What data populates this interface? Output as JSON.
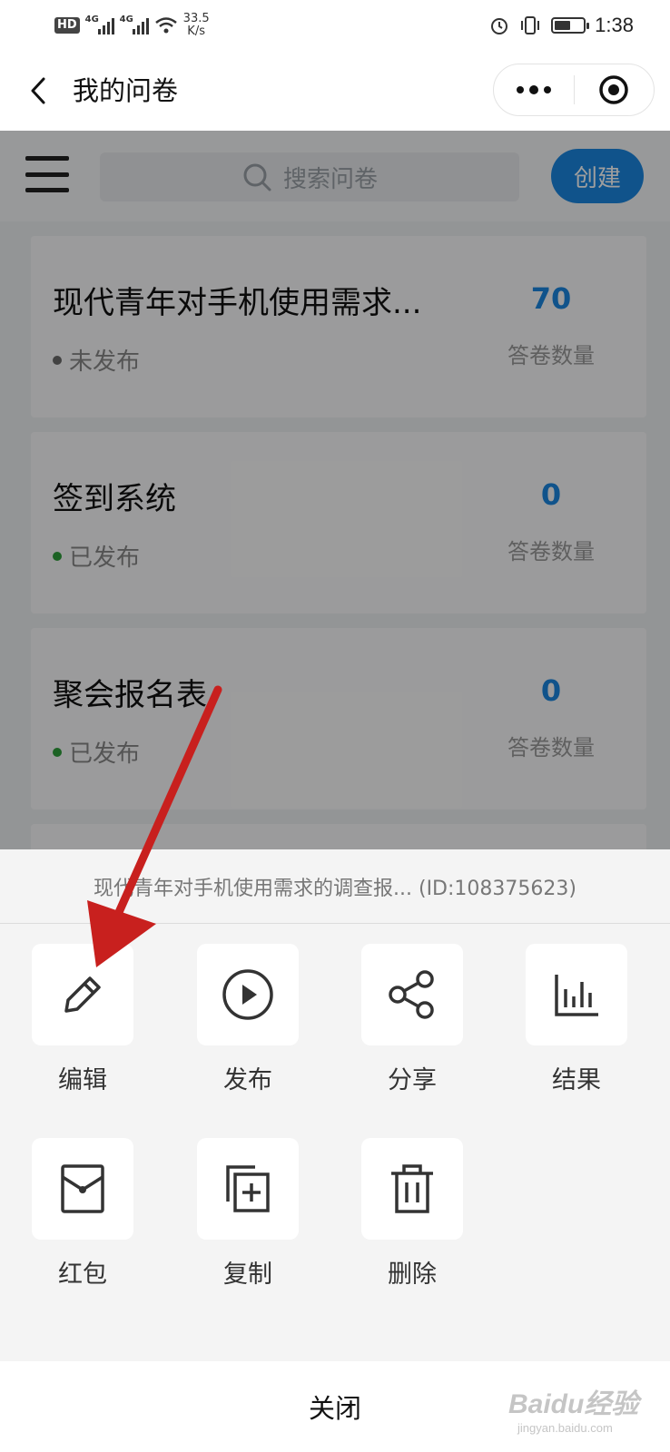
{
  "status_bar": {
    "network_a": "4G",
    "network_b": "4G",
    "speed_value": "33.5",
    "speed_unit": "K/s",
    "time": "1:38",
    "battery_level": 0.55
  },
  "nav": {
    "title": "我的问卷"
  },
  "toolbar": {
    "search_placeholder": "搜索问卷",
    "create_label": "创建"
  },
  "surveys": [
    {
      "title": "现代青年对手机使用需求...",
      "status": "未发布",
      "status_color": "#6b6b6b",
      "count": "70",
      "count_label": "答卷数量"
    },
    {
      "title": "签到系统",
      "status": "已发布",
      "status_color": "#2e9e3a",
      "count": "0",
      "count_label": "答卷数量"
    },
    {
      "title": "聚会报名表",
      "status": "已发布",
      "status_color": "#2e9e3a",
      "count": "0",
      "count_label": "答卷数量"
    }
  ],
  "sheet": {
    "header": "现代青年对手机使用需求的调查报... (ID:108375623)",
    "actions": [
      {
        "label": "编辑",
        "icon": "pencil-icon"
      },
      {
        "label": "发布",
        "icon": "play-circle-icon"
      },
      {
        "label": "分享",
        "icon": "share-icon"
      },
      {
        "label": "结果",
        "icon": "bar-chart-icon"
      },
      {
        "label": "红包",
        "icon": "red-envelope-icon"
      },
      {
        "label": "复制",
        "icon": "copy-icon"
      },
      {
        "label": "删除",
        "icon": "trash-icon"
      }
    ],
    "close_label": "关闭"
  },
  "colors": {
    "accent": "#1a87e0",
    "annotation_arrow": "#c8201e"
  },
  "watermark": {
    "brand": "Baidu经验",
    "url": "jingyan.baidu.com"
  }
}
